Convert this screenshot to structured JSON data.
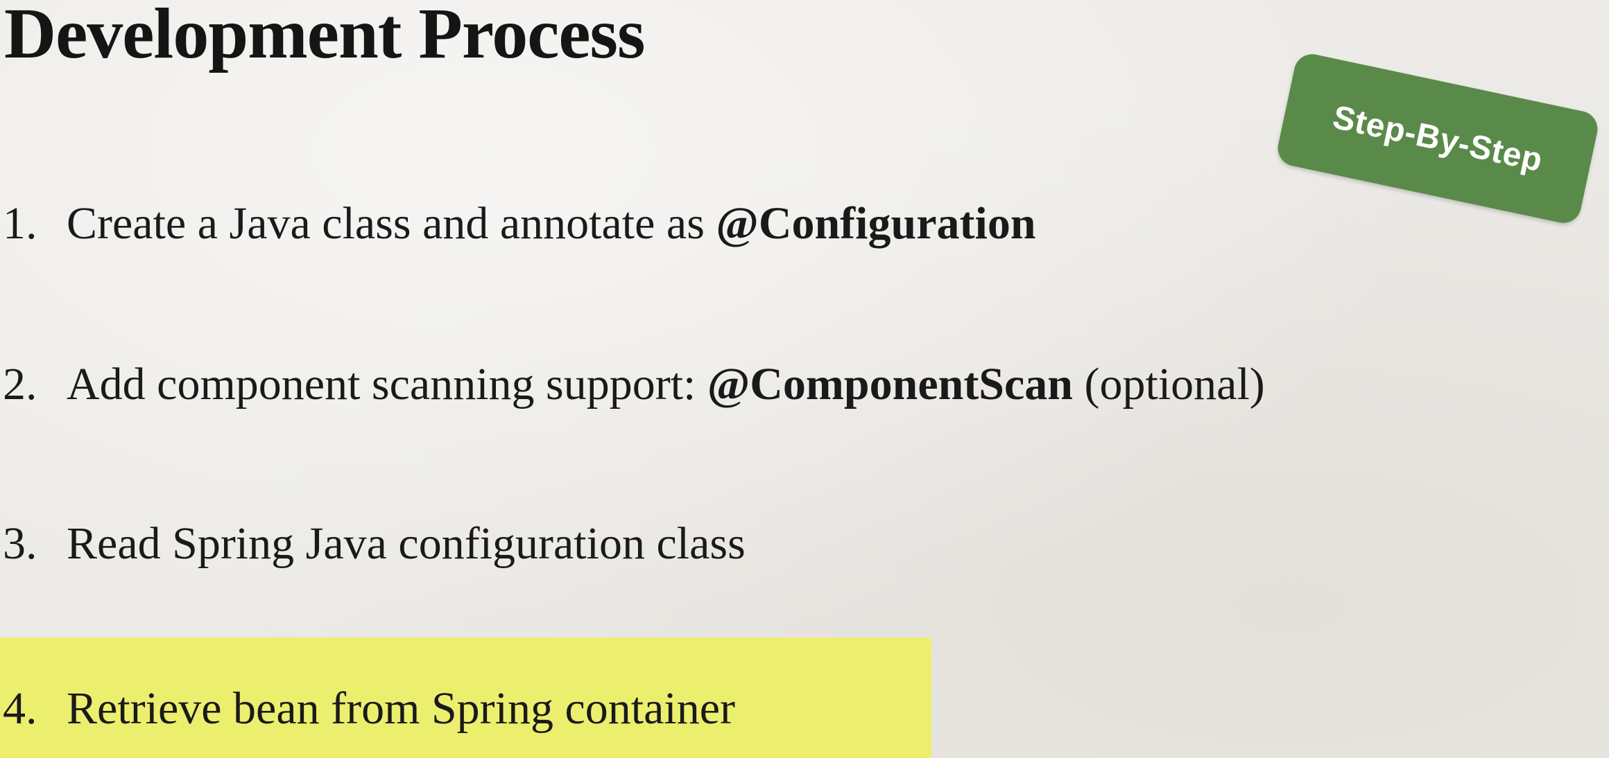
{
  "slide": {
    "title": "Development Process",
    "badge": "Step-By-Step",
    "steps": [
      {
        "num": "1.",
        "text": "Create a Java class and annotate as ",
        "bold": "@Configuration",
        "suffix": ""
      },
      {
        "num": "2.",
        "text": "Add component scanning support: ",
        "bold": "@ComponentScan",
        "suffix": " (optional)"
      },
      {
        "num": "3.",
        "text": "Read Spring Java configuration class",
        "bold": "",
        "suffix": ""
      },
      {
        "num": "4.",
        "text": "Retrieve bean from Spring container",
        "bold": "",
        "suffix": ""
      }
    ],
    "colors": {
      "background": "#eceae6",
      "badge": "#5a8a4a",
      "highlight": "#ecee6e"
    }
  }
}
